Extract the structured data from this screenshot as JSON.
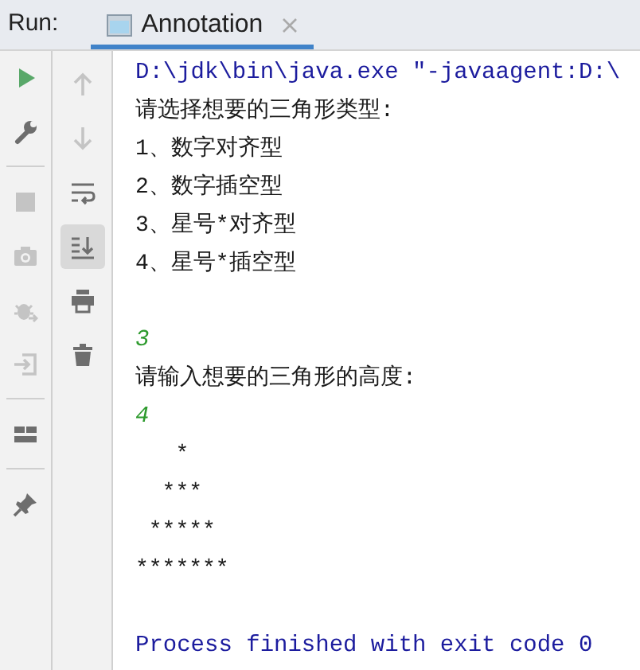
{
  "run_label": "Run:",
  "tabs": [
    {
      "label": "Annotation",
      "selected": true
    }
  ],
  "toolbar_left": [
    {
      "kind": "run",
      "disabled": false
    },
    {
      "kind": "wrench",
      "disabled": false
    },
    {
      "kind": "divider"
    },
    {
      "kind": "stop",
      "disabled": true
    },
    {
      "kind": "camera",
      "disabled": true
    },
    {
      "kind": "bug",
      "disabled": true
    },
    {
      "kind": "login",
      "disabled": true
    },
    {
      "kind": "divider"
    },
    {
      "kind": "layout",
      "disabled": false
    },
    {
      "kind": "divider"
    },
    {
      "kind": "pin",
      "disabled": false
    }
  ],
  "toolbar_right": [
    {
      "kind": "up",
      "disabled": true,
      "selected": false
    },
    {
      "kind": "down",
      "disabled": true,
      "selected": false
    },
    {
      "kind": "wrap",
      "disabled": false,
      "selected": false
    },
    {
      "kind": "scroll",
      "disabled": false,
      "selected": true
    },
    {
      "kind": "print",
      "disabled": false,
      "selected": false
    },
    {
      "kind": "trash",
      "disabled": false,
      "selected": false
    }
  ],
  "console": [
    {
      "kind": "system",
      "text": "D:\\jdk\\bin\\java.exe \"-javaagent:D:\\"
    },
    {
      "kind": "output",
      "text": "请选择想要的三角形类型:"
    },
    {
      "kind": "output",
      "text": "1、数字对齐型"
    },
    {
      "kind": "output",
      "text": "2、数字插空型"
    },
    {
      "kind": "output",
      "text": "3、星号*对齐型"
    },
    {
      "kind": "output",
      "text": "4、星号*插空型"
    },
    {
      "kind": "blank"
    },
    {
      "kind": "input",
      "text": "3"
    },
    {
      "kind": "output",
      "text": "请输入想要的三角形的高度:"
    },
    {
      "kind": "input",
      "text": "4"
    },
    {
      "kind": "output",
      "text": "   *\n  ***\n *****\n*******"
    },
    {
      "kind": "blank"
    },
    {
      "kind": "system",
      "text": "Process finished with exit code 0"
    }
  ]
}
